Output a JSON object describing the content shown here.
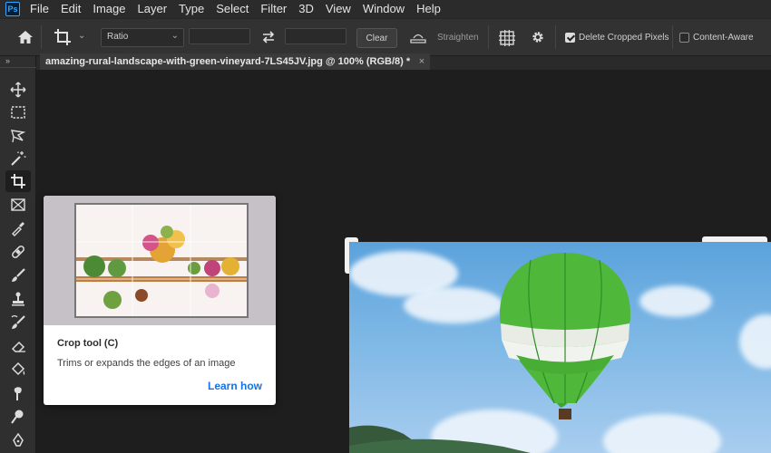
{
  "app": {
    "logo": "Ps"
  },
  "menu": [
    "File",
    "Edit",
    "Image",
    "Layer",
    "Type",
    "Select",
    "Filter",
    "3D",
    "View",
    "Window",
    "Help"
  ],
  "options": {
    "ratio_value": "Ratio",
    "width_value": "",
    "height_value": "",
    "clear_label": "Clear",
    "straighten_label": "Straighten",
    "delete_cropped_label": "Delete Cropped Pixels",
    "delete_cropped_checked": true,
    "content_aware_label": "Content-Aware",
    "content_aware_checked": false
  },
  "document": {
    "tab_title": "amazing-rural-landscape-with-green-vineyard-7LS45JV.jpg @ 100% (RGB/8) *",
    "close_glyph": "×"
  },
  "toolbar": {
    "collapse_glyph": "»",
    "tools": [
      "move-tool",
      "marquee-tool",
      "lasso-tool",
      "magic-wand-tool",
      "crop-tool",
      "frame-tool",
      "eyedropper-tool",
      "healing-brush-tool",
      "brush-tool",
      "clone-stamp-tool",
      "history-brush-tool",
      "eraser-tool",
      "paint-bucket-tool",
      "smudge-tool",
      "dodge-tool",
      "pen-tool"
    ],
    "active": "crop-tool"
  },
  "tooltip": {
    "title": "Crop tool (C)",
    "description": "Trims or expands the edges of an image",
    "link": "Learn how"
  },
  "colors": {
    "accent_blue": "#1473e6",
    "balloon_green": "#4fb83a",
    "canvas_bg": "#1e1e1e"
  }
}
